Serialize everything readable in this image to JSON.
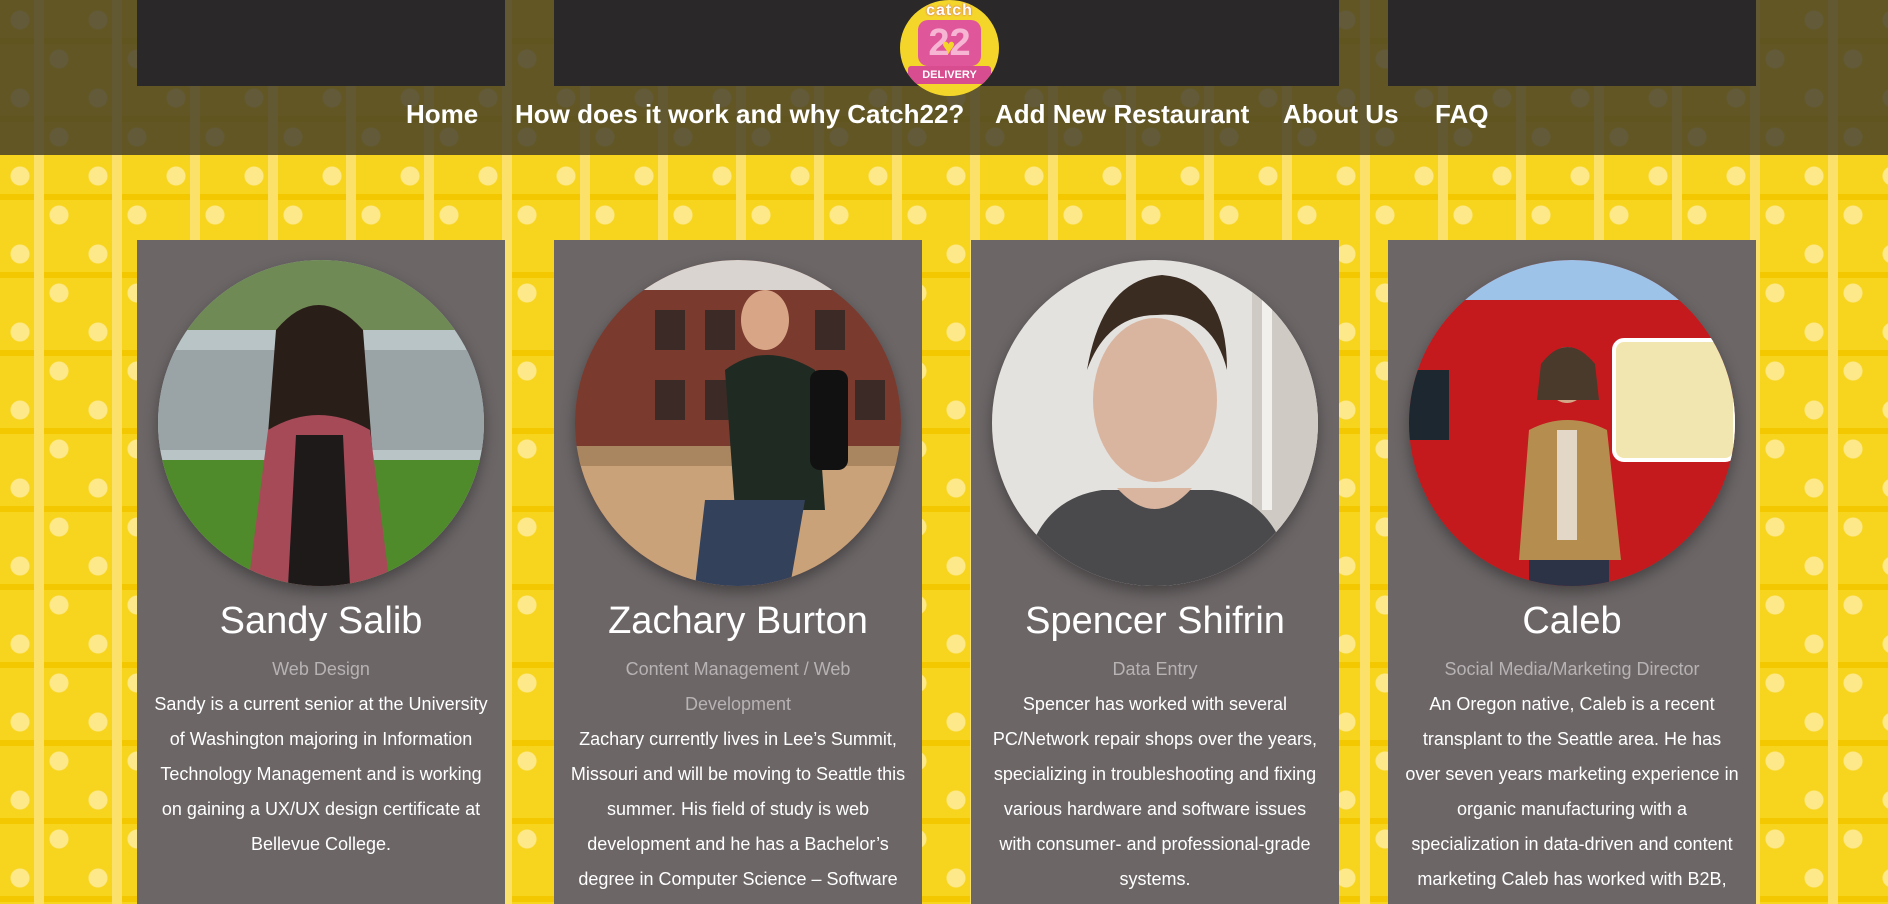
{
  "logo": {
    "top": "catch",
    "number": "22",
    "bottom": "DELIVERY"
  },
  "nav": [
    {
      "label": "Home"
    },
    {
      "label": "How does it work and why Catch22?"
    },
    {
      "label": "Add New Restaurant"
    },
    {
      "label": "About Us"
    },
    {
      "label": "FAQ"
    }
  ],
  "team": [
    {
      "name": "Sandy Salib",
      "role": "Web Design",
      "bio": "Sandy is a current senior at the University of Washington majoring in Information Technology Management and is working on gaining a UX/UX design certificate at Bellevue College.",
      "photo_colors": [
        "#8aa6a6",
        "#5e8a3c",
        "#a64a58",
        "#2a1e18"
      ]
    },
    {
      "name": "Zachary Burton",
      "role": "Content Management / Web Development",
      "bio": "Zachary currently lives in Lee’s Summit, Missouri and will be moving to Seattle this summer. His field of study is web development and he has a Bachelor’s degree in Computer Science – Software",
      "photo_colors": [
        "#7a3a2e",
        "#c9a27a",
        "#1f2a22",
        "#34415a"
      ]
    },
    {
      "name": "Spencer Shifrin",
      "role": "Data Entry",
      "bio": "Spencer has worked with several PC/Network repair shops over the years, specializing in troubleshooting and fixing various hardware and software issues with consumer- and professional-grade systems.",
      "photo_colors": [
        "#e4e2df",
        "#d9b5a0",
        "#3b2c22",
        "#4a4a4c"
      ]
    },
    {
      "name": "Caleb",
      "role": "Social Media/Marketing Director",
      "bio": "An Oregon native, Caleb is a recent transplant to the Seattle area. He has over seven years marketing experience in organic manufacturing with a specialization in data-driven and content marketing Caleb has worked with B2B,",
      "photo_colors": [
        "#c41a1e",
        "#9ec3e8",
        "#b58e4f",
        "#f2e6b0"
      ]
    }
  ]
}
